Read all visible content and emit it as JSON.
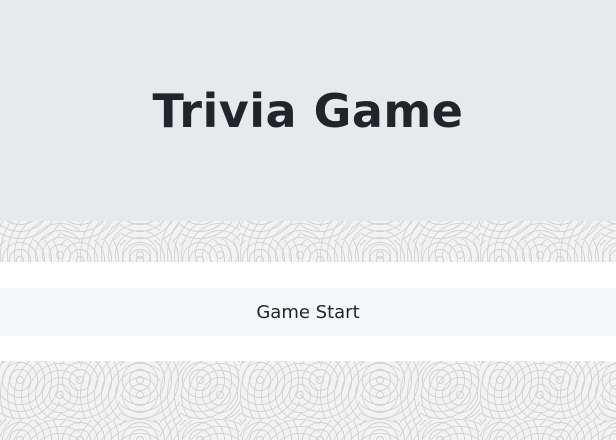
{
  "header": {
    "title": "Trivia Game"
  },
  "menu": {
    "start_label": "Game Start"
  },
  "colors": {
    "header_bg": "#e7eaed",
    "text": "#212529",
    "card_bg": "#ffffff",
    "start_bar_bg": "#f6f7f9"
  }
}
